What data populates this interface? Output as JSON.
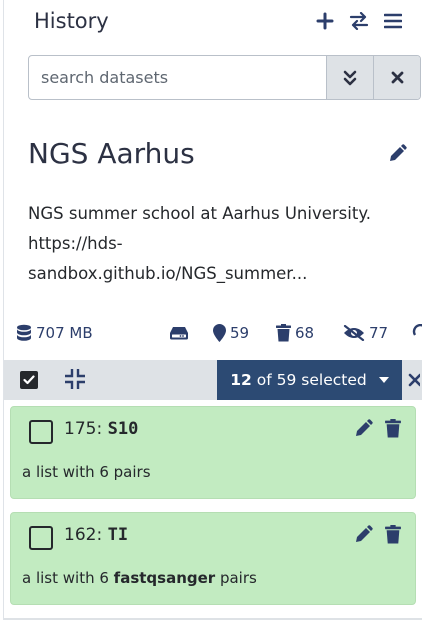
{
  "panel": {
    "title": "History"
  },
  "search": {
    "placeholder": "search datasets",
    "value": ""
  },
  "history": {
    "name": "NGS Aarhus",
    "annotation_line1": "NGS summer school at Aarhus University.",
    "annotation_line2": "https://hds-",
    "annotation_line3": "sandbox.github.io/NGS_summer..."
  },
  "stats": {
    "size": "707 MB",
    "shown": "59",
    "deleted": "68",
    "hidden": "77"
  },
  "selection": {
    "count": "12",
    "rest": "of 59 selected"
  },
  "items": [
    {
      "hid": "175:",
      "name": "S10",
      "desc_prefix": "a list with 6 pairs",
      "desc_bold": "",
      "desc_suffix": ""
    },
    {
      "hid": "162:",
      "name": "TI",
      "desc_prefix": "a list with 6 ",
      "desc_bold": "fastqsanger",
      "desc_suffix": " pairs"
    }
  ],
  "colors": {
    "item_ok": "#c2ebc1",
    "accent": "#2c4a73",
    "icon": "#2c3e6b"
  },
  "icons": [
    "plus-icon",
    "switch-icon",
    "menu-icon",
    "double-chevron-down-icon",
    "close-icon",
    "pencil-icon",
    "database-icon",
    "hdd-icon",
    "map-marker-icon",
    "trash-icon",
    "eye-slash-icon",
    "check-square-icon",
    "compress-icon"
  ]
}
